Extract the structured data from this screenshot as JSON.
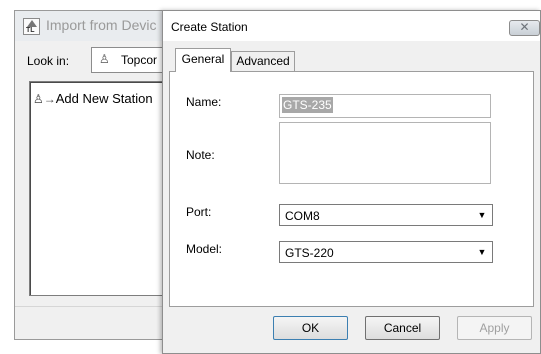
{
  "background_window": {
    "title": "Import from Devic",
    "look_in_label": "Look in:",
    "look_in_value": "Topcor",
    "list_items": [
      {
        "label": "Add New Station",
        "icon": "add-station-icon"
      }
    ]
  },
  "dialog": {
    "title": "Create Station",
    "close_label": "✕",
    "tabs": [
      {
        "label": "General",
        "selected": true
      },
      {
        "label": "Advanced",
        "selected": false
      }
    ],
    "fields": {
      "name_label": "Name:",
      "name_value": "GTS-235",
      "note_label": "Note:",
      "note_value": "",
      "port_label": "Port:",
      "port_value": "COM8",
      "model_label": "Model:",
      "model_value": "GTS-220"
    },
    "buttons": {
      "ok": "OK",
      "cancel": "Cancel",
      "apply": "Apply"
    }
  },
  "colors": {
    "dialog_bg": "#f0f0f0",
    "selection_bg": "#a8a8a8",
    "disabled_text": "#a0a0a0"
  }
}
